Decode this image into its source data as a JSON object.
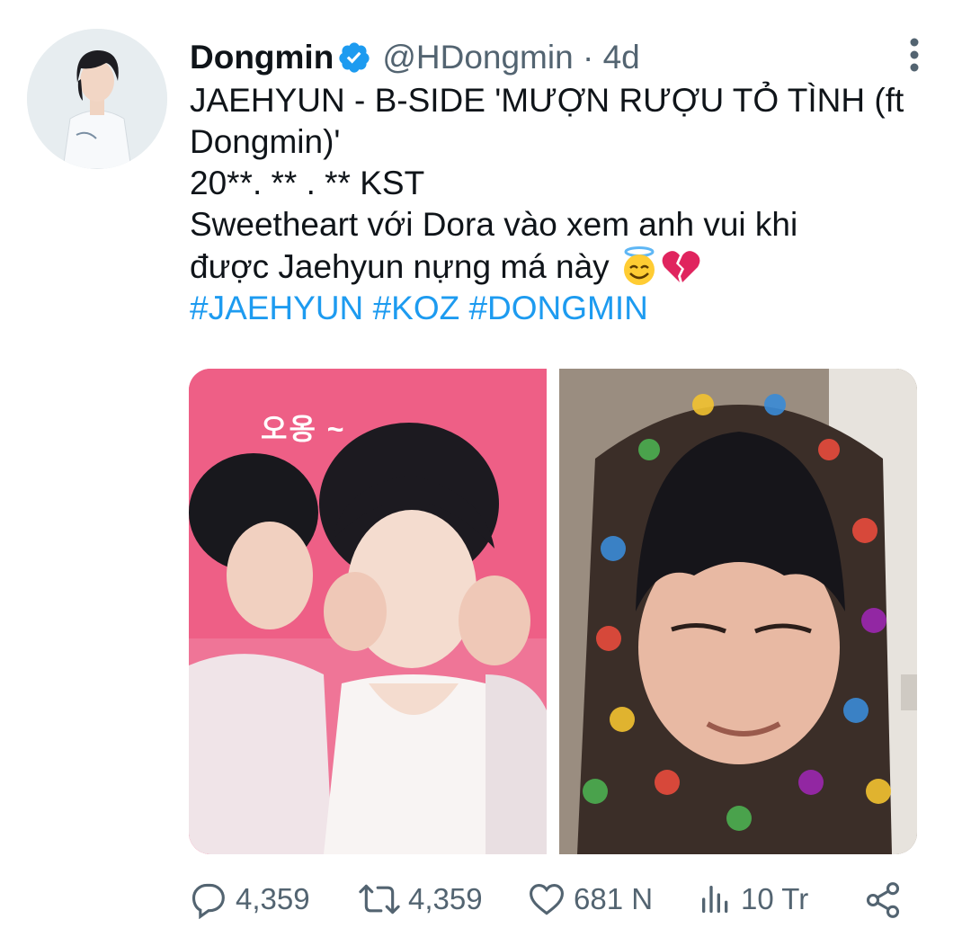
{
  "author": {
    "name": "Dongmin",
    "handle": "@HDongmin",
    "time": "4d",
    "verified": true,
    "avatar_icon": "profile-photo"
  },
  "tweet": {
    "line1": "JAEHYUN - B-SIDE 'MƯỢN RƯỢU TỎ TÌNH (ft",
    "line2": "Dongmin)'",
    "line3": "20**. ** . ** KST",
    "line4": "Sweetheart với Dora vào xem anh vui khi",
    "line5": "được Jaehyun nựng má này",
    "emojis": [
      "smiling-face-with-halo",
      "broken-heart"
    ],
    "hashtags": [
      "#JAEHYUN",
      "#KOZ",
      "#DONGMIN"
    ]
  },
  "media": {
    "left_overlay_text": "오옹 ~",
    "left_bg_color": "#ee5f86"
  },
  "actions": {
    "replies": "4,359",
    "retweets": "4,359",
    "likes": "681 N",
    "views": "10 Tr"
  },
  "colors": {
    "accent": "#1d9bf0",
    "muted": "#536471",
    "text": "#0f1419"
  }
}
